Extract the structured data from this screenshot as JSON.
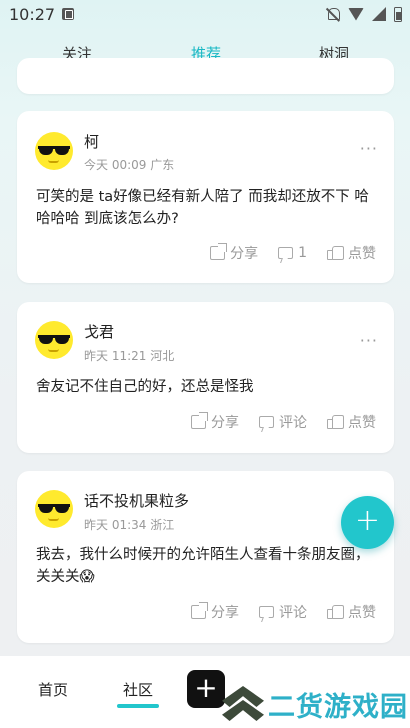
{
  "status_bar": {
    "time": "10:27"
  },
  "top_tabs": [
    {
      "label": "关注",
      "active": false
    },
    {
      "label": "推荐",
      "active": true
    },
    {
      "label": "树洞",
      "active": false
    }
  ],
  "posts": [
    {
      "name": "柯",
      "time": "今天 00:09",
      "location": "广东",
      "more": "···",
      "content": "可笑的是 ta好像已经有新人陪了 而我却还放不下 哈哈哈哈 到底该怎么办?",
      "share_label": "分享",
      "comment_label": "1",
      "like_label": "点赞"
    },
    {
      "name": "戈君",
      "time": "昨天 11:21",
      "location": "河北",
      "more": "···",
      "content": "舍友记不住自己的好，还总是怪我",
      "share_label": "分享",
      "comment_label": "评论",
      "like_label": "点赞"
    },
    {
      "name": "话不投机果粒多",
      "time": "昨天 01:34",
      "location": "浙江",
      "more": "",
      "content": "我去，我什么时候开的允许陌生人查看十条朋友圈，关关关😱",
      "share_label": "分享",
      "comment_label": "评论",
      "like_label": "点赞"
    }
  ],
  "fab": {
    "label": "+"
  },
  "bottom_nav": [
    {
      "label": "首页",
      "active": false
    },
    {
      "label": "社区",
      "active": true
    }
  ],
  "bottom_add": "+",
  "watermark": {
    "text": "二货游戏园"
  },
  "colors": {
    "accent": "#19b8c4",
    "fab": "#22c6cc",
    "avatar": "#ffea2e"
  }
}
